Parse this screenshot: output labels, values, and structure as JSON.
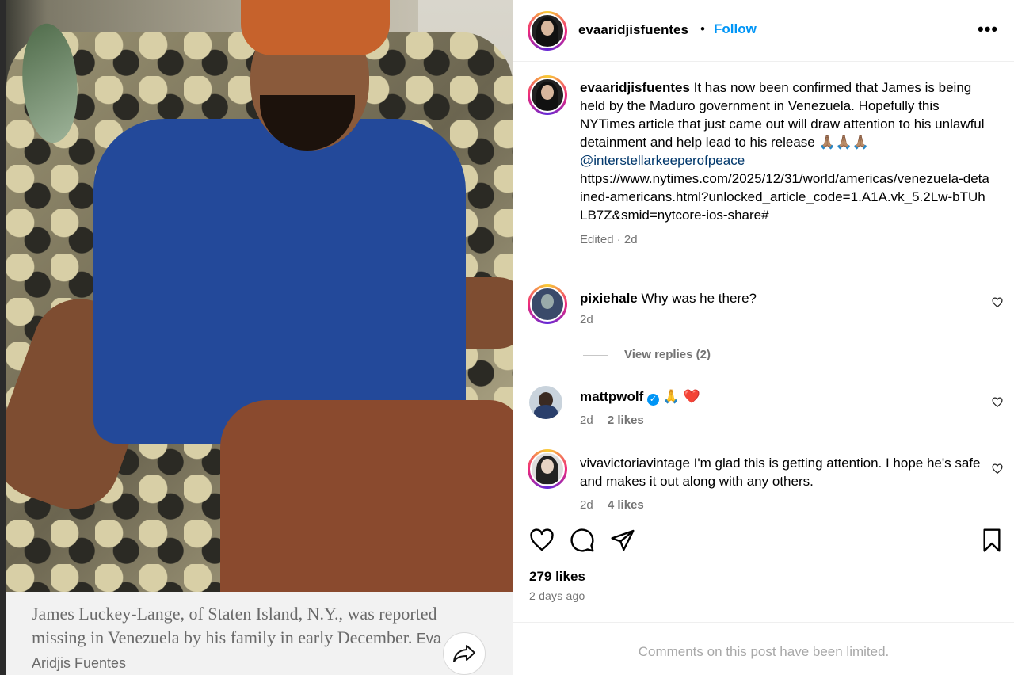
{
  "post": {
    "author": "evaaridjisfuentes",
    "separator": "•",
    "follow_label": "Follow",
    "more_label": "•••",
    "caption": {
      "username": "evaaridjisfuentes",
      "text": "It has now been confirmed that James is being held by the Maduro government in Venezuela. Hopefully this NYTimes article that just came out will draw attention to his unlawful detainment and help lead to his release 🙏🏽🙏🏽🙏🏽",
      "mention": "@interstellarkeeperofpeace",
      "link": "https://www.nytimes.com/2025/12/31/world/americas/venezuela-detained-americans.html?unlocked_article_code=1.A1A.vk_5.2Lw-bTUhLB7Z&smid=nytcore-ios-share#",
      "meta": "Edited · 2d"
    },
    "comments": [
      {
        "username": "pixiehale",
        "text": "Why was he there?",
        "time": "2d",
        "likes": ""
      },
      {
        "username": "mattpwolf",
        "verified": true,
        "text": "🙏 ❤️",
        "time": "2d",
        "likes": "2 likes"
      },
      {
        "username": "vivavictoriavintage",
        "text": "I'm glad this is getting attention. I hope he's safe and makes it out along with any others.",
        "time": "2d",
        "likes": "4 likes"
      }
    ],
    "view_replies": "View replies (2)",
    "likes_count": "279 likes",
    "posted_ago": "2 days ago",
    "limited_notice": "Comments on this post have been limited."
  },
  "media": {
    "caption_text": "James Luckey-Lange, of Staten Island, N.Y., was reported missing in Venezuela by his family in early December.",
    "caption_credit": "Eva Aridjis Fuentes"
  },
  "icons": {
    "like": "heart-icon",
    "comment": "comment-bubble-icon",
    "share": "paper-plane-icon",
    "save": "bookmark-icon",
    "media_share": "share-arrow-icon"
  },
  "colors": {
    "accent": "#0095f6",
    "secondary_text": "#737373",
    "mention": "#00376b"
  }
}
